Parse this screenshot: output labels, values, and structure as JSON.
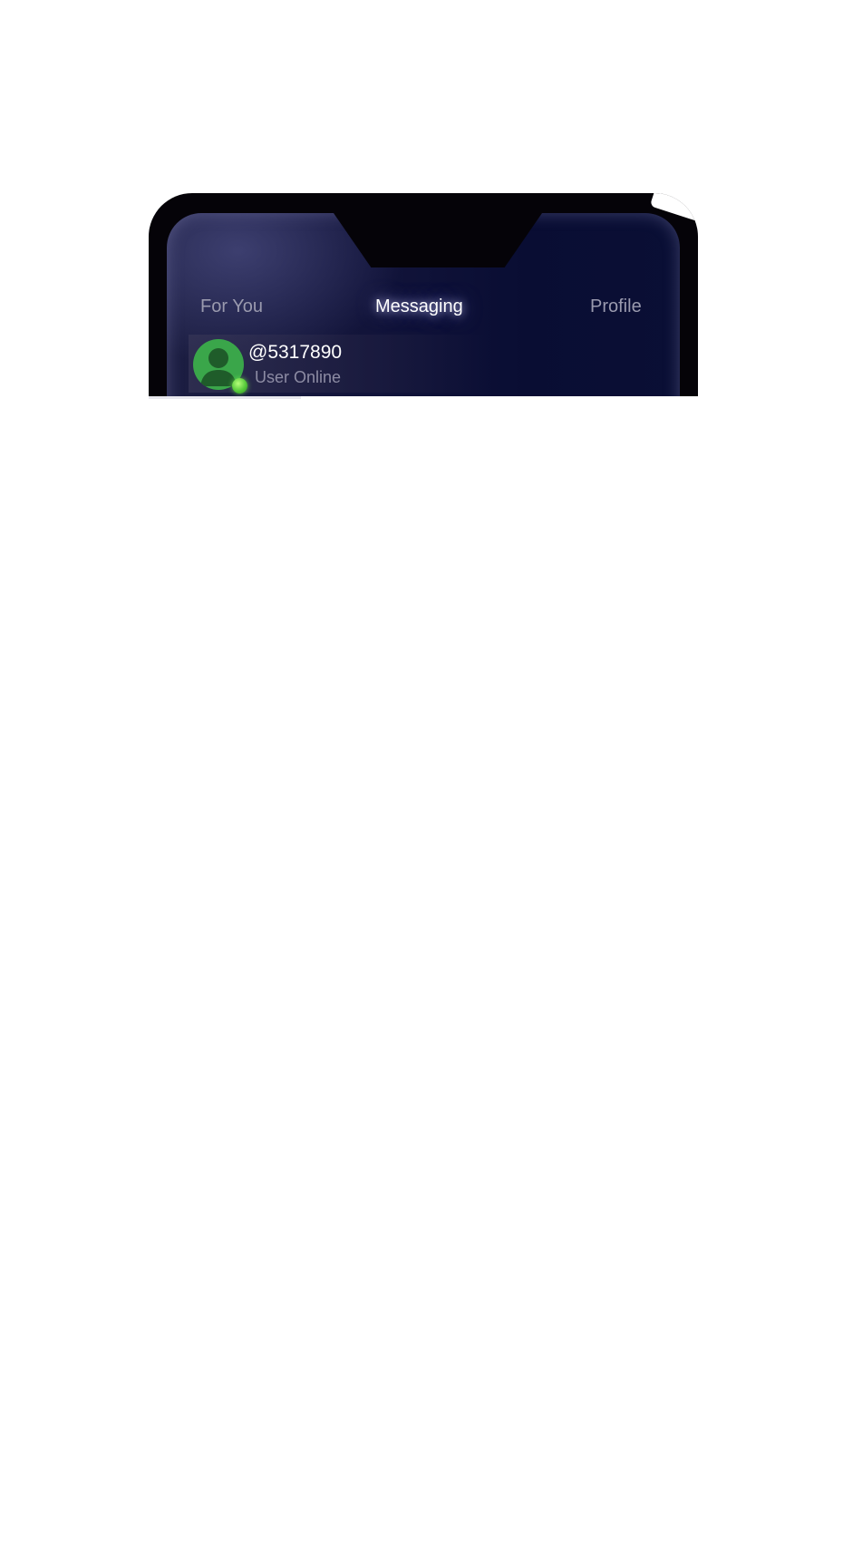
{
  "nav": {
    "tabs": [
      {
        "label": "For You",
        "active": false
      },
      {
        "label": "Messaging",
        "active": true
      },
      {
        "label": "Profile",
        "active": false
      }
    ]
  },
  "chat": {
    "username": "@5317890",
    "status": "User Online",
    "avatar_icon": "user-silhouette-icon",
    "online_indicator_color": "#55c93a"
  },
  "colors": {
    "screen_bg": "#12143a",
    "frame": "#050308",
    "avatar_bg": "#3aa64a",
    "active_tab_text": "#ffffff",
    "inactive_tab_text": "#9a9aae"
  }
}
